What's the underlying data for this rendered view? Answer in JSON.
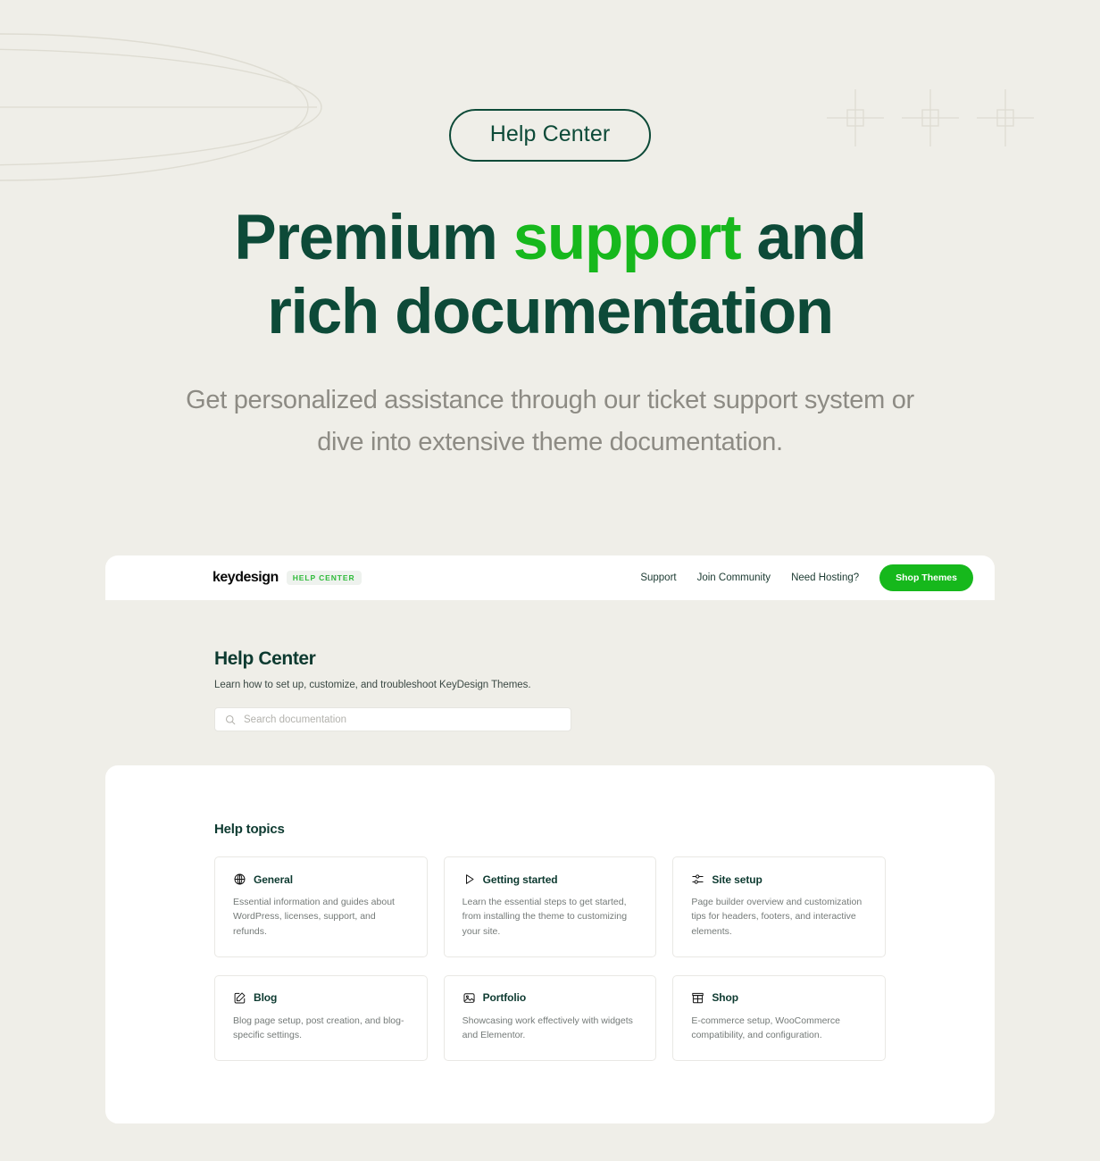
{
  "hero": {
    "badge": "Help Center",
    "title_part1": "Premium ",
    "title_accent": "support",
    "title_part2": " and",
    "title_line2": "rich documentation",
    "subtitle": "Get personalized assistance through our ticket support system or dive into extensive theme documentation.",
    "accent_color": "#17b81d",
    "text_color": "#0d4a38",
    "subtitle_color": "#8d8b84",
    "background_color": "#efeee8"
  },
  "navbar": {
    "brand": "keydesign",
    "brand_badge": "HELP CENTER",
    "links": [
      {
        "label": "Support"
      },
      {
        "label": "Join Community"
      },
      {
        "label": "Need Hosting?"
      }
    ],
    "cta_label": "Shop Themes",
    "cta_color": "#16b81c"
  },
  "help_center": {
    "title": "Help Center",
    "description": "Learn how to set up, customize, and troubleshoot KeyDesign Themes.",
    "search_placeholder": "Search documentation",
    "search_value": "",
    "search_icon": "search-icon"
  },
  "topics": {
    "title": "Help topics",
    "cards": [
      {
        "icon": "globe-icon",
        "title": "General",
        "desc": "Essential information and guides about WordPress, licenses, support, and refunds."
      },
      {
        "icon": "play-icon",
        "title": "Getting started",
        "desc": "Learn the essential steps to get started, from installing the theme to customizing your site."
      },
      {
        "icon": "sliders-icon",
        "title": "Site setup",
        "desc": "Page builder overview and customization tips for headers, footers, and interactive elements."
      },
      {
        "icon": "pencil-square-icon",
        "title": "Blog",
        "desc": "Blog page setup, post creation, and blog-specific settings."
      },
      {
        "icon": "image-icon",
        "title": "Portfolio",
        "desc": "Showcasing work effectively with widgets and Elementor."
      },
      {
        "icon": "store-icon",
        "title": "Shop",
        "desc": "E-commerce setup, WooCommerce compatibility, and configuration."
      }
    ]
  }
}
